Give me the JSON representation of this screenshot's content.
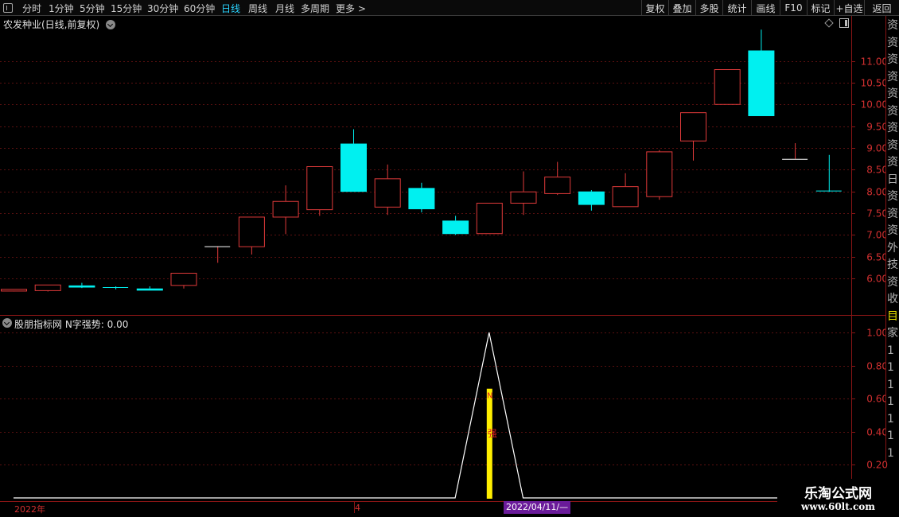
{
  "toolbar": {
    "tabs": [
      {
        "label": "分时"
      },
      {
        "label": "1分钟"
      },
      {
        "label": "5分钟"
      },
      {
        "label": "15分钟"
      },
      {
        "label": "30分钟"
      },
      {
        "label": "60分钟"
      },
      {
        "label": "日线",
        "active": true
      },
      {
        "label": "周线"
      },
      {
        "label": "月线"
      },
      {
        "label": "多周期"
      },
      {
        "label": "更多 >"
      }
    ],
    "right_buttons": [
      {
        "label": "复权"
      },
      {
        "label": "叠加"
      },
      {
        "label": "多股"
      },
      {
        "label": "统计"
      },
      {
        "label": "画线"
      },
      {
        "label": "F10"
      },
      {
        "label": "标记"
      },
      {
        "label": "+自选"
      },
      {
        "label": "返回"
      }
    ]
  },
  "main_panel": {
    "title": "农发种业(日线,前复权)"
  },
  "indicator_panel": {
    "title": "股朋指标网  N字强势: 0.00",
    "bar_text_top": "N",
    "bar_text_mid": "强"
  },
  "side_panel": {
    "chars": [
      "资",
      "资",
      "资",
      "资",
      "资",
      "资",
      "资",
      "资",
      "资",
      "日",
      "资",
      "资",
      "资",
      "外",
      "技",
      "资",
      "收",
      "目",
      "家",
      "1",
      "1",
      "1",
      "1",
      "1",
      "1",
      "1"
    ]
  },
  "x_axis": {
    "year_label": "2022年",
    "mid_label": "4",
    "cursor_date": "2022/04/11/—"
  },
  "watermark": {
    "title": "乐淘公式网",
    "url": "www.60lt.com"
  },
  "colors": {
    "up": "#e03a3a",
    "down": "#00f0f0",
    "grid": "#5a1010",
    "axis_label": "#d23030",
    "indicator_line": "#ffffff",
    "indicator_bar": "#ffee00"
  },
  "chart_data": [
    {
      "type": "candlestick",
      "title": "农发种业(日线,前复权)",
      "y_ticks": [
        6.0,
        6.5,
        7.0,
        7.5,
        8.0,
        8.5,
        9.0,
        9.5,
        10.0,
        10.5,
        11.0
      ],
      "y_tick_labels": [
        "6.00",
        "6.50",
        "7.00",
        "7.50",
        "8.00",
        "8.50",
        "9.00",
        "9.50",
        "10.00",
        "10.50",
        "11.00"
      ],
      "ylim": [
        5.6,
        11.45
      ],
      "candles": [
        {
          "o": 5.72,
          "h": 5.76,
          "l": 5.7,
          "c": 5.76,
          "up": true
        },
        {
          "o": 5.73,
          "h": 5.86,
          "l": 5.7,
          "c": 5.86,
          "up": true
        },
        {
          "o": 5.84,
          "h": 5.9,
          "l": 5.78,
          "c": 5.81,
          "up": false
        },
        {
          "o": 5.8,
          "h": 5.82,
          "l": 5.75,
          "c": 5.79,
          "up": false
        },
        {
          "o": 5.77,
          "h": 5.82,
          "l": 5.73,
          "c": 5.74,
          "up": false
        },
        {
          "o": 5.85,
          "h": 6.13,
          "l": 5.77,
          "c": 6.13,
          "up": true
        },
        {
          "o": 6.74,
          "h": 6.74,
          "l": 6.36,
          "c": 6.74,
          "up": true
        },
        {
          "o": 6.74,
          "h": 7.42,
          "l": 6.55,
          "c": 7.42,
          "up": true
        },
        {
          "o": 7.42,
          "h": 8.14,
          "l": 7.02,
          "c": 7.78,
          "up": true
        },
        {
          "o": 7.59,
          "h": 8.58,
          "l": 7.44,
          "c": 8.58,
          "up": true
        },
        {
          "o": 9.1,
          "h": 9.43,
          "l": 8.01,
          "c": 8.01,
          "up": false
        },
        {
          "o": 7.65,
          "h": 8.62,
          "l": 7.46,
          "c": 8.3,
          "up": true
        },
        {
          "o": 8.08,
          "h": 8.2,
          "l": 7.52,
          "c": 7.61,
          "up": false
        },
        {
          "o": 7.33,
          "h": 7.44,
          "l": 7.0,
          "c": 7.04,
          "up": false
        },
        {
          "o": 7.04,
          "h": 7.74,
          "l": 7.04,
          "c": 7.74,
          "up": true
        },
        {
          "o": 7.74,
          "h": 8.46,
          "l": 7.46,
          "c": 8.0,
          "up": true
        },
        {
          "o": 7.96,
          "h": 8.68,
          "l": 7.92,
          "c": 8.34,
          "up": true
        },
        {
          "o": 8.0,
          "h": 8.03,
          "l": 7.56,
          "c": 7.71,
          "up": false
        },
        {
          "o": 7.66,
          "h": 8.42,
          "l": 7.66,
          "c": 8.12,
          "up": true
        },
        {
          "o": 7.89,
          "h": 8.95,
          "l": 7.81,
          "c": 8.92,
          "up": true
        },
        {
          "o": 9.17,
          "h": 9.82,
          "l": 8.71,
          "c": 9.82,
          "up": true
        },
        {
          "o": 10.01,
          "h": 10.81,
          "l": 10.01,
          "c": 10.81,
          "up": true
        },
        {
          "o": 11.24,
          "h": 11.72,
          "l": 9.75,
          "c": 9.75,
          "up": false
        },
        {
          "o": 8.75,
          "h": 9.11,
          "l": 8.75,
          "c": 8.75,
          "up": true
        },
        {
          "o": 8.02,
          "h": 8.84,
          "l": 7.99,
          "c": 8.02,
          "up": false
        }
      ]
    },
    {
      "type": "line",
      "title": "股朋指标网  N字强势: 0.00",
      "y_ticks": [
        0.2,
        0.4,
        0.6,
        0.8,
        1.0
      ],
      "y_tick_labels": [
        "0.20",
        "0.40",
        "0.60",
        "0.80",
        "1.00"
      ],
      "ylim": [
        0.0,
        1.0
      ],
      "series": [
        {
          "values": [
            0,
            0,
            0,
            0,
            0,
            0,
            0,
            0,
            0,
            0,
            0,
            0,
            0,
            0,
            1,
            0,
            0,
            0,
            0,
            0,
            0,
            0,
            0,
            0,
            0
          ]
        }
      ],
      "bars": [
        {
          "index": 14,
          "value": 0.66
        }
      ]
    }
  ]
}
